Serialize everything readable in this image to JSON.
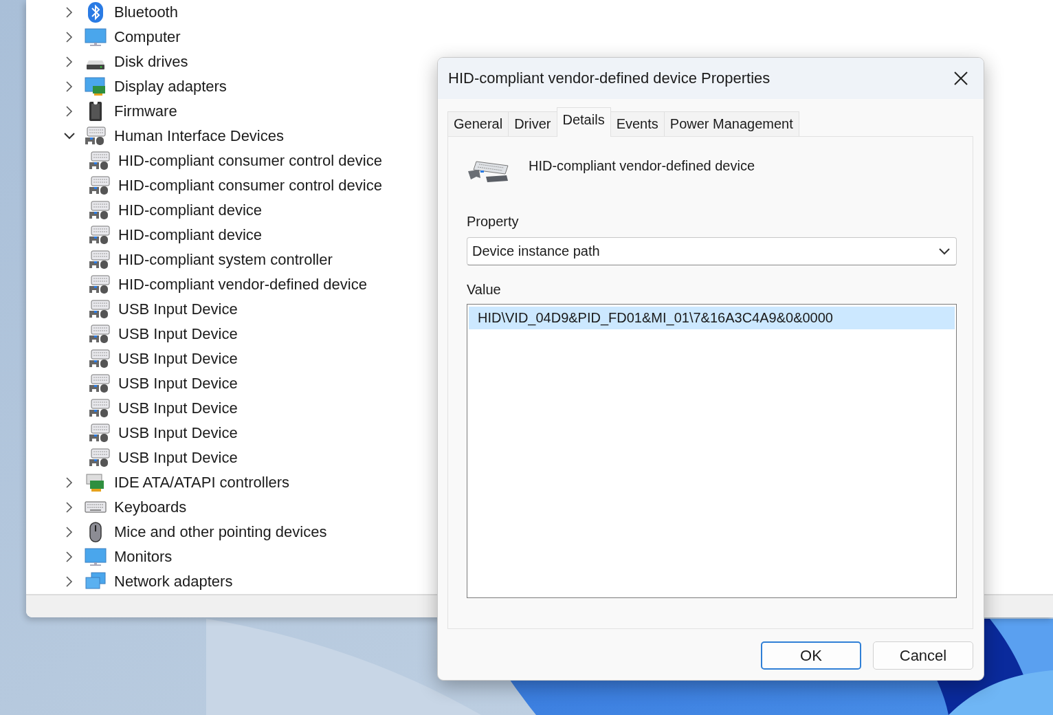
{
  "device_manager": {
    "tree": [
      {
        "label": "Bluetooth",
        "kind": "bluetooth",
        "expanded": false
      },
      {
        "label": "Computer",
        "kind": "computer",
        "expanded": false
      },
      {
        "label": "Disk drives",
        "kind": "disk",
        "expanded": false
      },
      {
        "label": "Display adapters",
        "kind": "display",
        "expanded": false
      },
      {
        "label": "Firmware",
        "kind": "firmware",
        "expanded": false
      },
      {
        "label": "Human Interface Devices",
        "kind": "hid",
        "expanded": true,
        "children": [
          {
            "label": "HID-compliant consumer control device",
            "kind": "hid"
          },
          {
            "label": "HID-compliant consumer control device",
            "kind": "hid"
          },
          {
            "label": "HID-compliant device",
            "kind": "hid"
          },
          {
            "label": "HID-compliant device",
            "kind": "hid"
          },
          {
            "label": "HID-compliant system controller",
            "kind": "hid"
          },
          {
            "label": "HID-compliant vendor-defined device",
            "kind": "hid"
          },
          {
            "label": "USB Input Device",
            "kind": "hid"
          },
          {
            "label": "USB Input Device",
            "kind": "hid"
          },
          {
            "label": "USB Input Device",
            "kind": "hid"
          },
          {
            "label": "USB Input Device",
            "kind": "hid"
          },
          {
            "label": "USB Input Device",
            "kind": "hid"
          },
          {
            "label": "USB Input Device",
            "kind": "hid"
          },
          {
            "label": "USB Input Device",
            "kind": "hid"
          }
        ]
      },
      {
        "label": "IDE ATA/ATAPI controllers",
        "kind": "ide",
        "expanded": false
      },
      {
        "label": "Keyboards",
        "kind": "keyboard",
        "expanded": false
      },
      {
        "label": "Mice and other pointing devices",
        "kind": "mouse",
        "expanded": false
      },
      {
        "label": "Monitors",
        "kind": "monitor",
        "expanded": false
      },
      {
        "label": "Network adapters",
        "kind": "network",
        "expanded": false
      }
    ]
  },
  "dialog": {
    "title": "HID-compliant vendor-defined device Properties",
    "tabs": [
      {
        "label": "General",
        "selected": false
      },
      {
        "label": "Driver",
        "selected": false
      },
      {
        "label": "Details",
        "selected": true
      },
      {
        "label": "Events",
        "selected": false
      },
      {
        "label": "Power Management",
        "selected": false
      }
    ],
    "device_name": "HID-compliant vendor-defined device",
    "property_label": "Property",
    "property": {
      "value": "Device instance path"
    },
    "value_label": "Value",
    "values": [
      {
        "text": "HID\\VID_04D9&PID_FD01&MI_01\\7&16A3C4A9&0&0000",
        "selected": true
      }
    ],
    "buttons": [
      {
        "label": "OK",
        "default": true
      },
      {
        "label": "Cancel",
        "default": false
      }
    ]
  }
}
